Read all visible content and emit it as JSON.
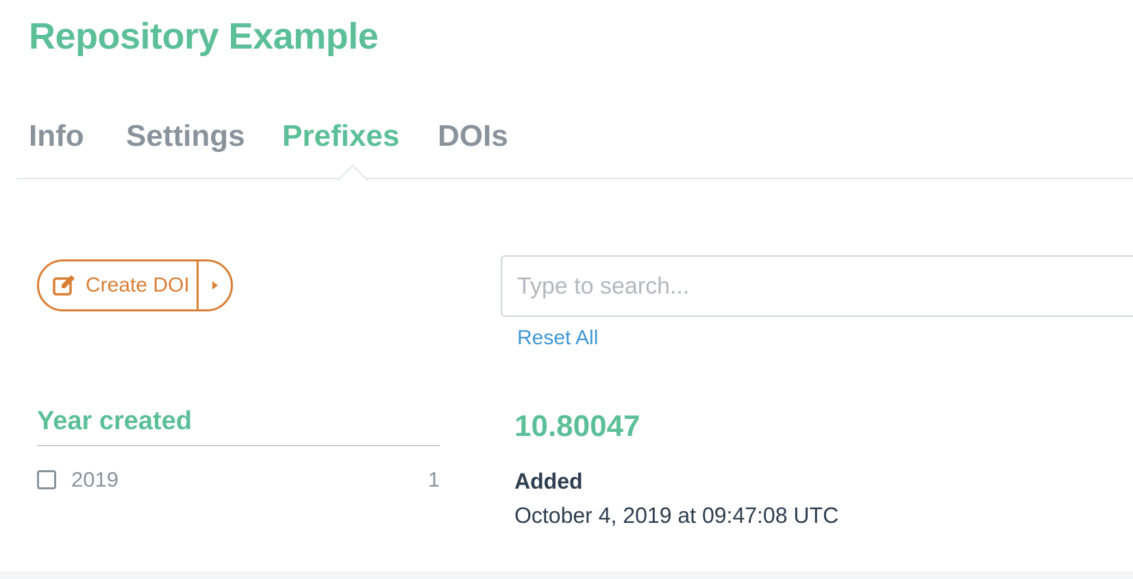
{
  "header": {
    "title": "Repository Example"
  },
  "tabs": [
    {
      "label": "Info"
    },
    {
      "label": "Settings"
    },
    {
      "label": "Prefixes"
    },
    {
      "label": "DOIs"
    }
  ],
  "active_tab": "Prefixes",
  "toolbar": {
    "create_doi_label": "Create DOI"
  },
  "search": {
    "placeholder": "Type to search...",
    "value": "",
    "reset_label": "Reset All"
  },
  "facets": {
    "year_created": {
      "title": "Year created",
      "items": [
        {
          "label": "2019",
          "count": "1",
          "checked": false
        }
      ]
    }
  },
  "prefix": {
    "name": "10.80047",
    "added_label": "Added",
    "added_value": "October 4, 2019 at 09:47:08 UTC"
  },
  "icons": {
    "create": "edit-icon",
    "toggle": "caret-right-icon",
    "checkbox": "checkbox-icon"
  },
  "colors": {
    "accent": "#5cbf9a",
    "tab_inactive": "#8a939c",
    "button": "#d97f35",
    "link": "#3f97d6",
    "text_dark": "#2f3e50"
  }
}
